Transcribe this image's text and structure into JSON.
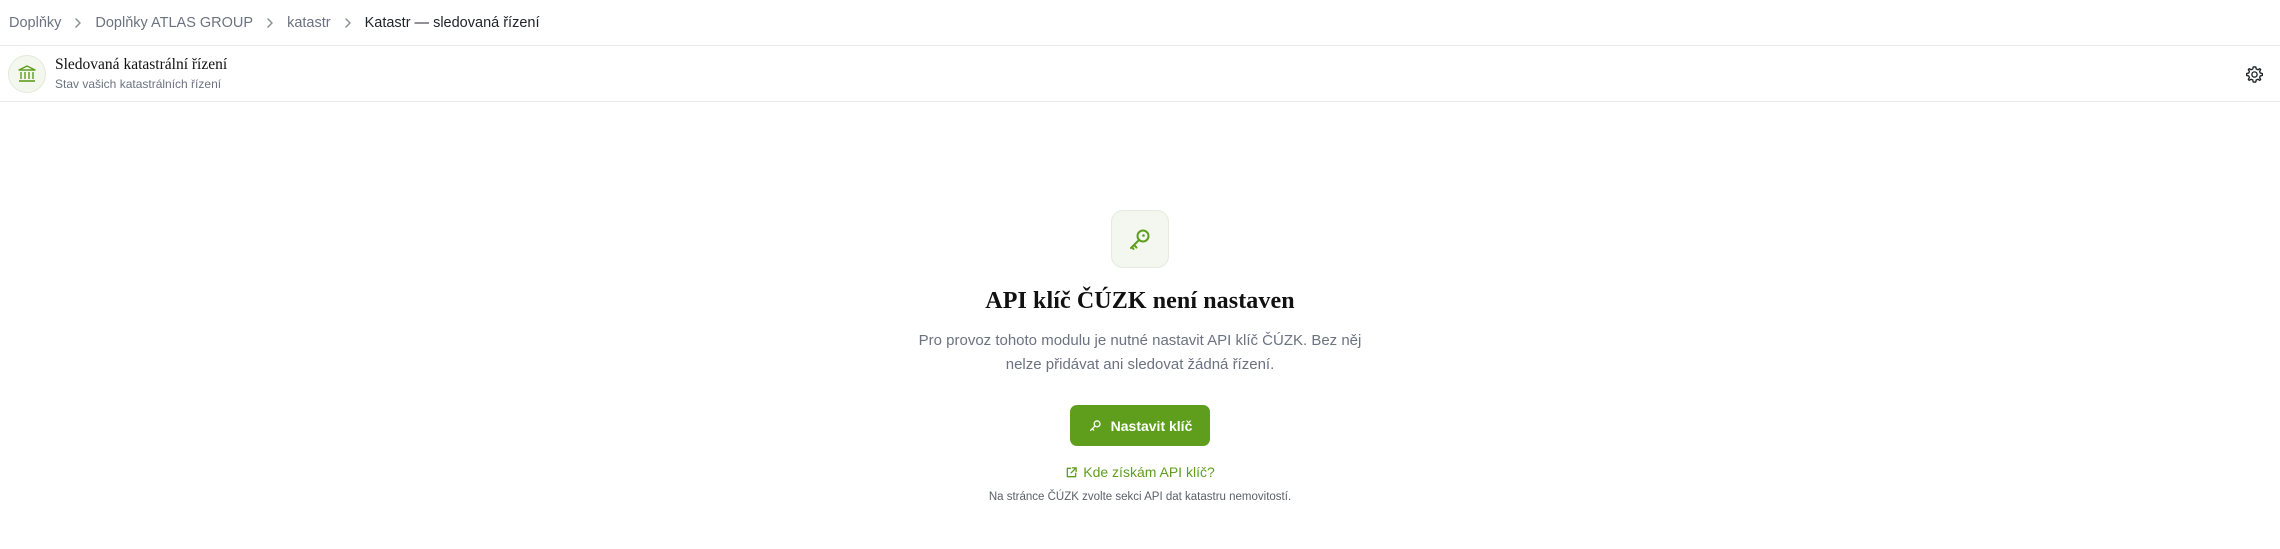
{
  "breadcrumb": {
    "items": [
      "Doplňky",
      "Doplňky ATLAS GROUP",
      "katastr"
    ],
    "current": "Katastr — sledovaná řízení"
  },
  "header": {
    "icon": "bank-icon",
    "title": "Sledovaná katastrální řízení",
    "subtitle": "Stav vašich katastrálních řízení",
    "settings_icon": "gear-icon"
  },
  "empty_state": {
    "icon": "key-icon",
    "title": "API klíč ČÚZK není nastaven",
    "description": "Pro provoz tohoto modulu je nutné nastavit API klíč ČÚZK. Bez něj nelze přidávat ani sledovat žádná řízení.",
    "button_label": "Nastavit klíč",
    "link_label": "Kde získám API klíč?",
    "note": "Na stránce ČÚZK zvolte sekci API dat katastru nemovitostí."
  },
  "colors": {
    "accent": "#5f9e1d",
    "muted_text": "#6b7280"
  }
}
